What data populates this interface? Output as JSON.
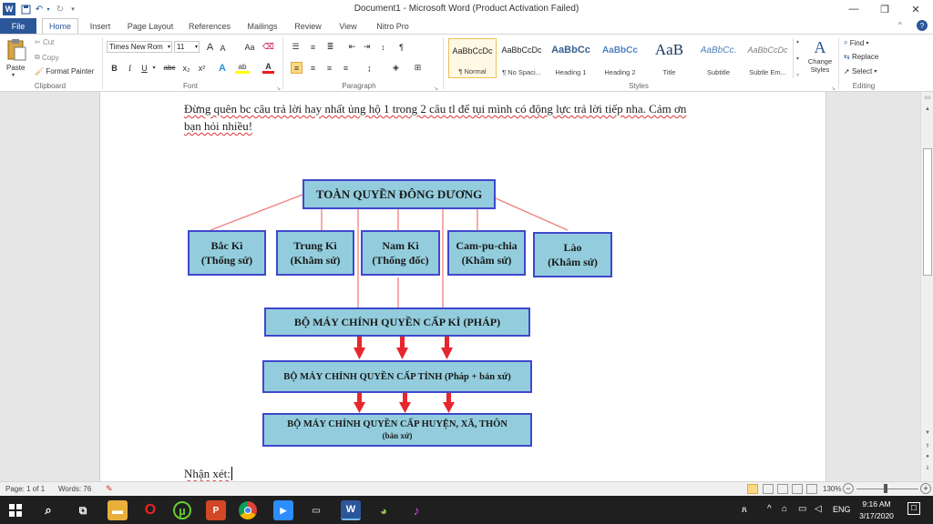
{
  "app": {
    "title": "Document1  -  Microsoft Word (Product Activation Failed)",
    "word_icon_letter": "W"
  },
  "tabs": [
    "File",
    "Home",
    "Insert",
    "Page Layout",
    "References",
    "Mailings",
    "Review",
    "View",
    "Nitro Pro"
  ],
  "clipboard": {
    "paste": "Paste",
    "cut": "Cut",
    "copy": "Copy",
    "format_painter": "Format Painter",
    "label": "Clipboard"
  },
  "font": {
    "name": "Times New Rom",
    "size": "11",
    "label": "Font",
    "bold": "B",
    "italic": "I",
    "underline": "U",
    "strike": "abc",
    "sub": "x₂",
    "sup": "x²",
    "grow": "A",
    "shrink": "A",
    "case": "Aa",
    "highlight": "ab",
    "color": "A"
  },
  "paragraph": {
    "label": "Paragraph",
    "pilcrow": "¶"
  },
  "styles": {
    "label": "Styles",
    "items": [
      {
        "preview": "AaBbCcDc",
        "name": "¶ Normal"
      },
      {
        "preview": "AaBbCcDc",
        "name": "¶ No Spaci..."
      },
      {
        "preview": "AaBbCc",
        "name": "Heading 1"
      },
      {
        "preview": "AaBbCc",
        "name": "Heading 2"
      },
      {
        "preview": "AaB",
        "name": "Title"
      },
      {
        "preview": "AaBbCc.",
        "name": "Subtitle"
      },
      {
        "preview": "AaBbCcDc",
        "name": "Subtle Em..."
      }
    ],
    "change_styles": "Change Styles"
  },
  "editing": {
    "label": "Editing",
    "find": "Find",
    "replace": "Replace",
    "select": "Select"
  },
  "document": {
    "line1": "Đừng quên bc câu trả lời hay nhất ủng hộ 1 trong 2 câu tl để tụi mình có động lực trả lời tiếp nha. Cảm ơn",
    "line2": "bạn hỏi nhiều!",
    "comment_label": "Nhận xét:"
  },
  "diagram": {
    "top": "TOÀN QUYỀN ĐÔNG DƯƠNG",
    "regions": [
      {
        "name": "Bắc Kì",
        "role": "(Thống sứ)"
      },
      {
        "name": "Trung Kì",
        "role": "(Khâm sứ)"
      },
      {
        "name": "Nam Kì",
        "role": "(Thống đốc)"
      },
      {
        "name": "Cam-pu-chia",
        "role": "(Khâm sứ)"
      },
      {
        "name": "Lào",
        "role": "(Khâm sứ)"
      }
    ],
    "level_ky": "BỘ MÁY CHÍNH QUYỀN CẤP KÌ (PHÁP)",
    "level_tinh": "BỘ MÁY CHÍNH QUYỀN CẤP TỈNH (Pháp + bản xứ)",
    "level_huyen": "BỘ MÁY CHÍNH QUYỀN CẤP HUYỆN, XÃ, THÔN",
    "level_huyen_sub": "(bản xứ)"
  },
  "status": {
    "page": "Page: 1 of 1",
    "words": "Words: 76",
    "zoom": "130%"
  },
  "taskbar": {
    "time": "9:16 AM",
    "date": "3/17/2020",
    "lang": "ENG"
  },
  "colors": {
    "accent": "#2b579a",
    "box_fill": "#93cddd",
    "box_border": "#3f48cc",
    "arrow": "#e8262d",
    "connector": "#f08080"
  }
}
